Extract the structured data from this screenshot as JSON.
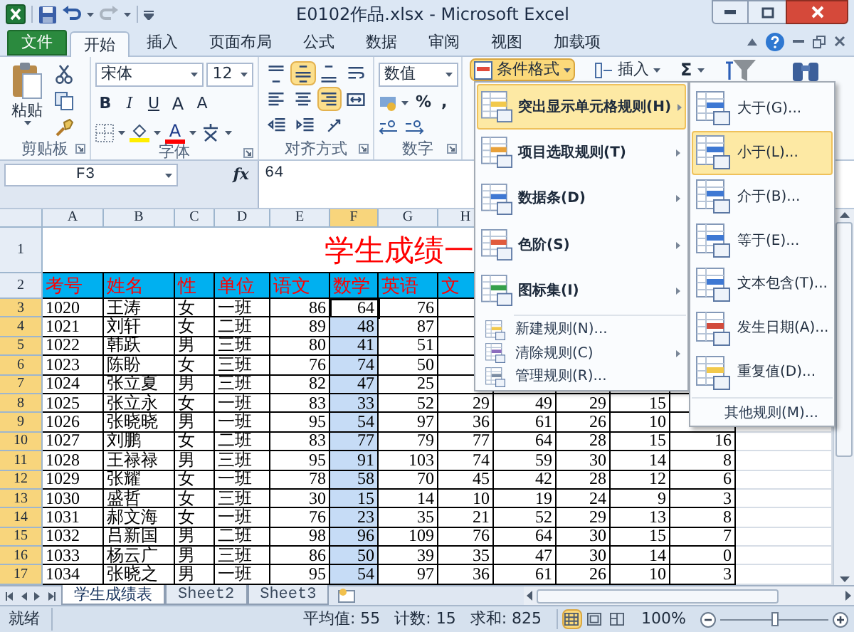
{
  "window": {
    "title": "E0102作品.xlsx - Microsoft Excel"
  },
  "ribbon_tabs": [
    {
      "label": "文件",
      "kind": "file",
      "selected": false
    },
    {
      "label": "开始",
      "kind": "tab",
      "selected": true
    },
    {
      "label": "插入",
      "kind": "tab",
      "selected": false
    },
    {
      "label": "页面布局",
      "kind": "tab",
      "selected": false
    },
    {
      "label": "公式",
      "kind": "tab",
      "selected": false
    },
    {
      "label": "数据",
      "kind": "tab",
      "selected": false
    },
    {
      "label": "审阅",
      "kind": "tab",
      "selected": false
    },
    {
      "label": "视图",
      "kind": "tab",
      "selected": false
    },
    {
      "label": "加载项",
      "kind": "tab",
      "selected": false
    }
  ],
  "clipboard": {
    "paste": "粘贴",
    "group": "剪贴板"
  },
  "font": {
    "name": "宋体",
    "size": "12",
    "group": "字体",
    "color_button": "A",
    "style_buttons": [
      {
        "label": "B",
        "kind": "bold"
      },
      {
        "label": "I",
        "kind": "italic"
      },
      {
        "label": "U",
        "kind": "underline"
      },
      {
        "label": "A",
        "kind": "grow"
      },
      {
        "label": "A",
        "kind": "shrink"
      }
    ]
  },
  "alignment": {
    "group": "对齐方式",
    "buttons": [
      {
        "kind": "top",
        "selected": false
      },
      {
        "kind": "middle",
        "selected": true
      },
      {
        "kind": "bottom",
        "selected": false
      },
      {
        "kind": "wrap",
        "selected": false
      },
      {
        "kind": "left",
        "selected": false
      },
      {
        "kind": "center",
        "selected": false
      },
      {
        "kind": "right",
        "selected": true
      },
      {
        "kind": "merge",
        "selected": false
      },
      {
        "kind": "outdent",
        "selected": false
      },
      {
        "kind": "indent",
        "selected": false
      },
      {
        "kind": "orientation",
        "selected": false
      }
    ]
  },
  "number": {
    "format": "数值",
    "group": "数字",
    "buttons": [
      "%",
      ","
    ]
  },
  "styles": {
    "conditional_formatting": {
      "label": "条件格式",
      "active": true
    }
  },
  "cells": {
    "insert": "插入"
  },
  "editing": {
    "sum": "Σ"
  },
  "formula_bar": {
    "name_box": "F3",
    "function_label": "fx",
    "value": "64"
  },
  "sheet": {
    "title": "学生成绩一",
    "columns": [
      {
        "label": "A",
        "selected": false
      },
      {
        "label": "B",
        "selected": false
      },
      {
        "label": "C",
        "selected": false
      },
      {
        "label": "D",
        "selected": false
      },
      {
        "label": "E",
        "selected": false
      },
      {
        "label": "F",
        "selected": true
      },
      {
        "label": "G",
        "selected": false
      },
      {
        "label": "H",
        "selected": false
      }
    ],
    "rows": [
      {
        "header": "1",
        "kind": "title",
        "selected": false
      },
      {
        "header": "2",
        "kind": "header",
        "selected": false,
        "cells": [
          "考号",
          "姓名",
          "性",
          "单位",
          "语文",
          "数学",
          "英语",
          "文"
        ]
      },
      {
        "header": "3",
        "kind": "data",
        "selected": true,
        "active": true,
        "cells": [
          "1020",
          "王涛",
          "女",
          "一班",
          "86",
          "64",
          "76"
        ]
      },
      {
        "header": "4",
        "kind": "data",
        "selected": true,
        "active": false,
        "cells": [
          "1021",
          "刘轩",
          "女",
          "二班",
          "89",
          "48",
          "87"
        ]
      },
      {
        "header": "5",
        "kind": "data",
        "selected": true,
        "active": false,
        "cells": [
          "1022",
          "韩跃",
          "男",
          "三班",
          "80",
          "41",
          "51"
        ]
      },
      {
        "header": "6",
        "kind": "data",
        "selected": true,
        "active": false,
        "cells": [
          "1023",
          "陈盼",
          "女",
          "三班",
          "76",
          "74",
          "50"
        ]
      },
      {
        "header": "7",
        "kind": "data",
        "selected": true,
        "active": false,
        "cells": [
          "1024",
          "张立夏",
          "男",
          "三班",
          "82",
          "47",
          "25"
        ]
      },
      {
        "header": "8",
        "kind": "data",
        "selected": true,
        "active": false,
        "cells": [
          "1025",
          "张立永",
          "女",
          "一班",
          "83",
          "33",
          "52",
          "29",
          "49",
          "29",
          "15"
        ]
      },
      {
        "header": "9",
        "kind": "data",
        "selected": true,
        "active": false,
        "cells": [
          "1026",
          "张晓晓",
          "男",
          "一班",
          "95",
          "54",
          "97",
          "36",
          "61",
          "26",
          "10"
        ]
      },
      {
        "header": "10",
        "kind": "data",
        "selected": true,
        "active": false,
        "cells": [
          "1027",
          "刘鹏",
          "女",
          "二班",
          "83",
          "77",
          "79",
          "77",
          "64",
          "28",
          "15",
          "16"
        ]
      },
      {
        "header": "11",
        "kind": "data",
        "selected": true,
        "active": false,
        "cells": [
          "1028",
          "王禄禄",
          "男",
          "三班",
          "95",
          "91",
          "103",
          "74",
          "59",
          "30",
          "14",
          "8"
        ]
      },
      {
        "header": "12",
        "kind": "data",
        "selected": true,
        "active": false,
        "cells": [
          "1029",
          "张耀",
          "女",
          "一班",
          "78",
          "58",
          "70",
          "45",
          "42",
          "28",
          "12",
          "6"
        ]
      },
      {
        "header": "13",
        "kind": "data",
        "selected": true,
        "active": false,
        "cells": [
          "1030",
          "盛哲",
          "女",
          "三班",
          "30",
          "15",
          "14",
          "10",
          "19",
          "24",
          "9",
          "3"
        ]
      },
      {
        "header": "14",
        "kind": "data",
        "selected": true,
        "active": false,
        "cells": [
          "1031",
          "郝文海",
          "女",
          "一班",
          "76",
          "23",
          "35",
          "21",
          "52",
          "29",
          "13",
          "8"
        ]
      },
      {
        "header": "15",
        "kind": "data",
        "selected": true,
        "active": false,
        "cells": [
          "1032",
          "吕新国",
          "男",
          "二班",
          "98",
          "96",
          "109",
          "76",
          "64",
          "30",
          "15",
          "7"
        ]
      },
      {
        "header": "16",
        "kind": "data",
        "selected": true,
        "active": false,
        "cells": [
          "1033",
          "杨云广",
          "男",
          "三班",
          "86",
          "50",
          "39",
          "35",
          "47",
          "30",
          "14",
          "0"
        ]
      },
      {
        "header": "17",
        "kind": "data",
        "selected": true,
        "active": false,
        "cells": [
          "1034",
          "张晓之",
          "男",
          "一班",
          "95",
          "54",
          "97",
          "36",
          "61",
          "26",
          "10",
          "3"
        ]
      }
    ]
  },
  "conditional_menu": {
    "items": [
      {
        "label": "突出显示单元格规则(H)",
        "kind": "large",
        "submenu": true,
        "selected": true
      },
      {
        "label": "项目选取规则(T)",
        "kind": "large",
        "submenu": true,
        "selected": false
      },
      {
        "label": "数据条(D)",
        "kind": "large",
        "submenu": true,
        "selected": false
      },
      {
        "label": "色阶(S)",
        "kind": "large",
        "submenu": true,
        "selected": false
      },
      {
        "label": "图标集(I)",
        "kind": "large",
        "submenu": true,
        "selected": false
      },
      {
        "label": "新建规则(N)...",
        "kind": "small",
        "submenu": false,
        "selected": false
      },
      {
        "label": "清除规则(C)",
        "kind": "small",
        "submenu": true,
        "selected": false
      },
      {
        "label": "管理规则(R)...",
        "kind": "small",
        "submenu": false,
        "selected": false
      }
    ]
  },
  "rules_submenu": {
    "items": [
      {
        "label": "大于(G)...",
        "kind": "rule",
        "selected": false
      },
      {
        "label": "小于(L)...",
        "kind": "rule",
        "selected": true
      },
      {
        "label": "介于(B)...",
        "kind": "rule",
        "selected": false
      },
      {
        "label": "等于(E)...",
        "kind": "rule",
        "selected": false
      },
      {
        "label": "文本包含(T)...",
        "kind": "rule",
        "selected": false
      },
      {
        "label": "发生日期(A)...",
        "kind": "rule",
        "selected": false
      },
      {
        "label": "重复值(D)...",
        "kind": "rule",
        "selected": false
      },
      {
        "label": "其他规则(M)...",
        "kind": "more",
        "selected": false
      }
    ]
  },
  "sheet_tabs": [
    {
      "label": "学生成绩表",
      "selected": true
    },
    {
      "label": "Sheet2",
      "selected": false
    },
    {
      "label": "Sheet3",
      "selected": false
    }
  ],
  "status_bar": {
    "ready": "就绪",
    "average": "平均值: 55",
    "count": "计数: 15",
    "sum": "求和: 825",
    "views": [
      {
        "kind": "normal",
        "selected": true
      },
      {
        "kind": "layout",
        "selected": false
      },
      {
        "kind": "pagebreak",
        "selected": false
      }
    ],
    "zoom": {
      "label": "100%",
      "level": 0.5
    }
  }
}
